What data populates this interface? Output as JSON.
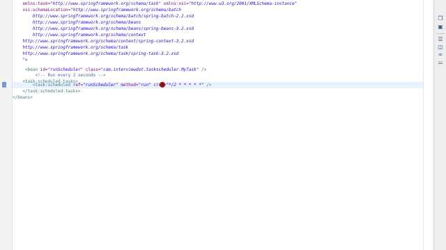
{
  "editor": {
    "lines": [
      [
        {
          "t": "    xmlns:task=",
          "c": "attr"
        },
        {
          "t": "\"http://www.springframework.org/schema/task\"",
          "c": "val"
        },
        {
          "t": " xmlns:xsi=",
          "c": "attr"
        },
        {
          "t": "\"http://www.w3.org/2001/XMLSchema-instance\"",
          "c": "val"
        }
      ],
      [
        {
          "t": "    xsi:schemaLocation=",
          "c": "attr"
        },
        {
          "t": "\"http://www.springframework.org/schema/batch",
          "c": "val"
        }
      ],
      [
        {
          "t": "        http://www.springframework.org/schema/batch/spring-batch-2.2.xsd",
          "c": "val"
        }
      ],
      [
        {
          "t": "        http://www.springframework.org/schema/beans",
          "c": "val"
        }
      ],
      [
        {
          "t": "        http://www.springframework.org/schema/beans/spring-beans-3.2.xsd",
          "c": "val"
        }
      ],
      [
        {
          "t": "        http://www.springframework.org/schema/context",
          "c": "val"
        }
      ],
      [
        {
          "t": "    http://www.springframework.org/schema/context/spring-context-3.2.xsd",
          "c": "val"
        }
      ],
      [
        {
          "t": "    http://www.springframework.org/schema/task",
          "c": "val"
        }
      ],
      [
        {
          "t": "    http://www.springframework.org/schema/task/spring-task-3.2.xsd",
          "c": "val"
        }
      ],
      [
        {
          "t": "    \">",
          "c": "val"
        }
      ],
      [
        {
          "t": "",
          "c": "plain"
        }
      ],
      [
        {
          "t": "     <bean ",
          "c": "tag"
        },
        {
          "t": "id=",
          "c": "attr"
        },
        {
          "t": "\"runScheduler\"",
          "c": "val"
        },
        {
          "t": " class=",
          "c": "attr"
        },
        {
          "t": "\"com.interviewdot.taskscheduler.MyTask\"",
          "c": "val"
        },
        {
          "t": " />",
          "c": "tag"
        }
      ],
      [
        {
          "t": "         <!-- Run every 2 seconds -->",
          "c": "cmt"
        }
      ],
      [
        {
          "t": "    <task:scheduled-tasks>",
          "c": "tag"
        }
      ],
      [
        {
          "t": "        <task:scheduled ",
          "c": "tag"
        },
        {
          "t": "ref=",
          "c": "attr"
        },
        {
          "t": "\"runScheduler\"",
          "c": "val"
        },
        {
          "t": " method=",
          "c": "attr"
        },
        {
          "t": "\"run\"",
          "c": "val"
        },
        {
          "t": " cron=",
          "c": "attr"
        },
        {
          "t": "\"*/2 * * * * *\"",
          "c": "val"
        },
        {
          "t": " />",
          "c": "tag"
        }
      ],
      [
        {
          "t": "    </task:scheduled-tasks>",
          "c": "tag"
        }
      ],
      [
        {
          "t": "</beans>",
          "c": "tag"
        }
      ]
    ],
    "current_line_index": 14
  },
  "side_panel": {
    "icons": [
      "restore-icon",
      "maximize-icon",
      "outline-icon",
      "hierarchy-icon",
      "link-icon",
      "tree-icon"
    ]
  }
}
